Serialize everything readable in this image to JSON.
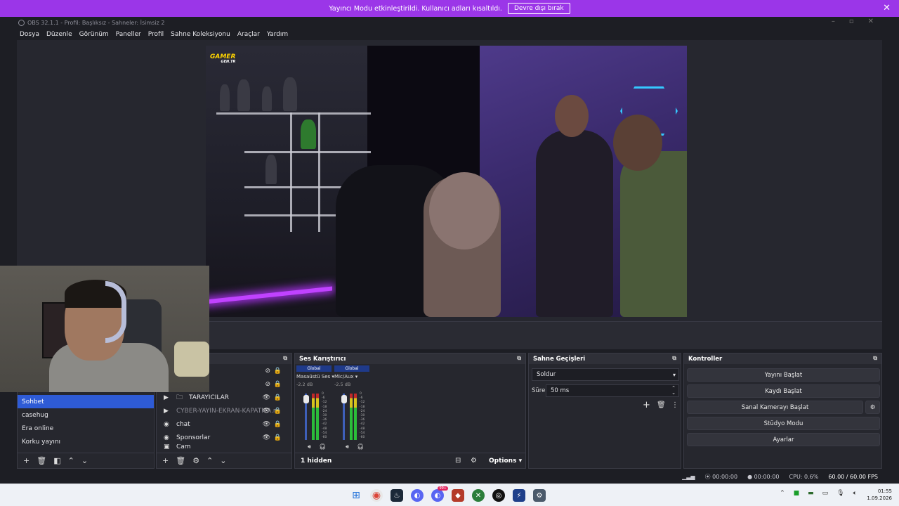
{
  "banner": {
    "message": "Yayıncı Modu etkinleştirildi. Kullanıcı adları kısaltıldı.",
    "button": "Devre dışı bırak"
  },
  "window": {
    "title": "OBS 32.1.1 - Profil: Başlıksız - Sahneler: İsimsiz 2"
  },
  "menu": [
    "Dosya",
    "Düzenle",
    "Görünüm",
    "Paneller",
    "Profil",
    "Sahne Koleksiyonu",
    "Araçlar",
    "Yardım"
  ],
  "preview": {
    "logo_main": "GAMER",
    "logo_sub": "GEN.TR"
  },
  "scenes": {
    "items": [
      "Sohbet",
      "casehug",
      "Era online",
      "Korku yayını"
    ],
    "selected": 0
  },
  "sources": {
    "items": [
      {
        "label": "TARAYICILAR",
        "icon": "folder-icon",
        "dim": false
      },
      {
        "label": "CYBER-YAYIN-EKRAN-KAPATMA.m",
        "icon": "play-icon",
        "dim": true
      },
      {
        "label": "chat",
        "icon": "globe-icon",
        "dim": false
      },
      {
        "label": "Sponsorlar",
        "icon": "globe-icon",
        "dim": false
      },
      {
        "label": "Cam",
        "icon": "camera-icon",
        "dim": false
      }
    ]
  },
  "mixer": {
    "title": "Ses Karıştırıcı",
    "channels": [
      {
        "badge": "Global",
        "name": "Masaüstü Ses",
        "db": "-2.2 dB"
      },
      {
        "badge": "Global",
        "name": "Mic/Aux",
        "db": "-2.5 dB"
      }
    ],
    "scale": [
      "0",
      "-6",
      "-12",
      "-18",
      "-24",
      "-30",
      "-36",
      "-42",
      "-48",
      "-54",
      "-60"
    ],
    "hidden_label": "1 hidden",
    "options_label": "Options"
  },
  "transitions": {
    "title": "Sahne Geçişleri",
    "selected": "Soldur",
    "duration_label": "Süre",
    "duration_value": "50 ms"
  },
  "controls": {
    "title": "Kontroller",
    "buttons": [
      "Yayını Başlat",
      "Kaydı Başlat",
      "Sanal Kamerayı Başlat",
      "Stüdyo Modu",
      "Ayarlar"
    ]
  },
  "status": {
    "stream_time": "00:00:00",
    "record_time": "00:00:00",
    "cpu": "CPU: 0.6%",
    "fps": "60.00 / 60.00 FPS"
  },
  "taskbar": {
    "time": "01:55",
    "date": "1.09.2026",
    "badge": "99+"
  }
}
